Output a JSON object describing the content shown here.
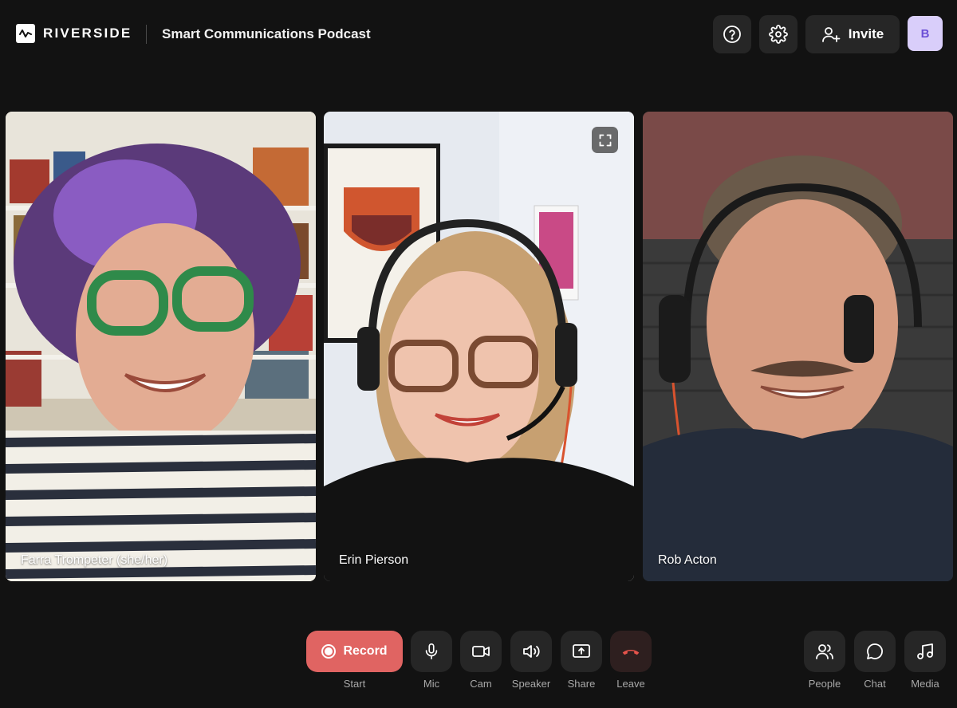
{
  "brand": {
    "name": "RIVERSIDE"
  },
  "header": {
    "project_title": "Smart Communications Podcast",
    "invite_label": "Invite",
    "avatar_initial": "B"
  },
  "participants": [
    {
      "name": "Farra Trompeter (she/her)"
    },
    {
      "name": "Erin Pierson"
    },
    {
      "name": "Rob Acton"
    }
  ],
  "controls": {
    "record_label": "Record",
    "start_label": "Start",
    "mic_label": "Mic",
    "cam_label": "Cam",
    "speaker_label": "Speaker",
    "share_label": "Share",
    "leave_label": "Leave",
    "people_label": "People",
    "chat_label": "Chat",
    "media_label": "Media"
  },
  "colors": {
    "background": "#121212",
    "button": "#262626",
    "record": "#e06462",
    "leave_icon": "#e5534b",
    "avatar_bg": "#d9cefa",
    "avatar_fg": "#6b4fd6"
  }
}
